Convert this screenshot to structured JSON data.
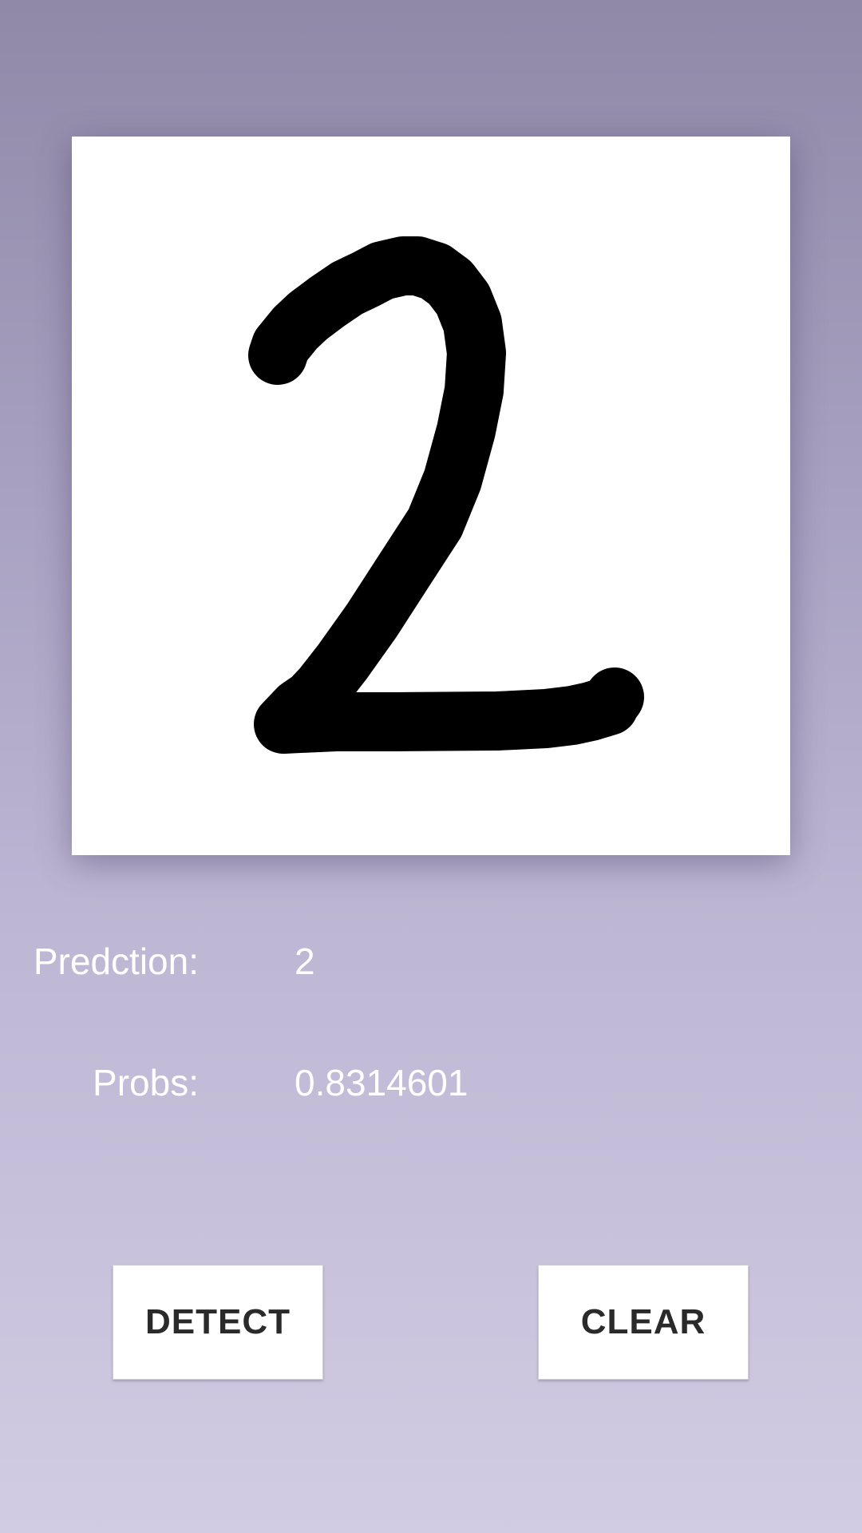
{
  "prediction": {
    "label": "Predction:",
    "value": "2"
  },
  "probs": {
    "label": "Probs:",
    "value": "0.8314601"
  },
  "buttons": {
    "detect_label": "DETECT",
    "clear_label": "CLEAR"
  },
  "colors": {
    "background_top": "#9089a8",
    "background_bottom": "#d1cbe3",
    "canvas": "#ffffff",
    "stroke": "#000000",
    "text": "#ffffff"
  }
}
